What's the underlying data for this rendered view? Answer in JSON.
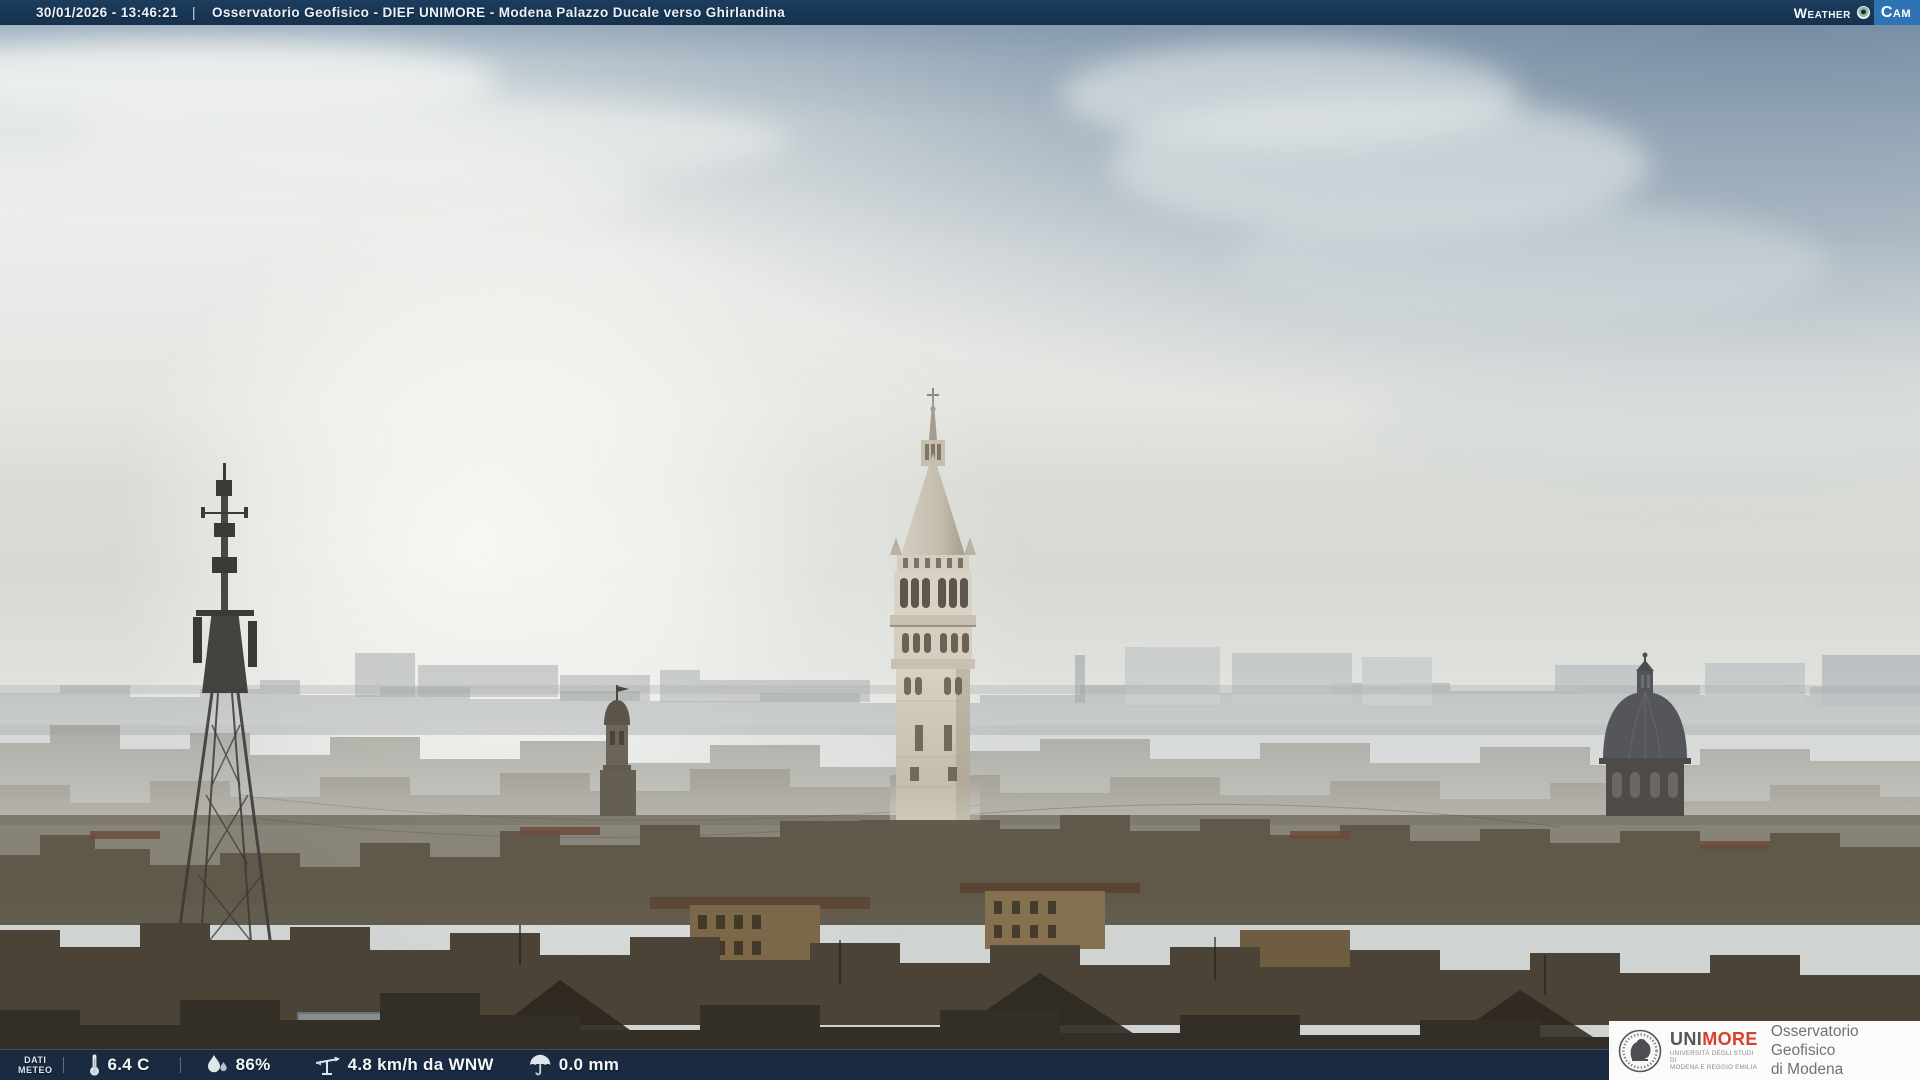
{
  "header": {
    "datetime": "30/01/2026 - 13:46:21",
    "separator": "|",
    "title": "Osservatorio Geofisico - DIEF UNIMORE - Modena Palazzo Ducale verso Ghirlandina",
    "logo": {
      "weather": "Weather",
      "cam": "Cam"
    }
  },
  "footer": {
    "label_line1": "DATI",
    "label_line2": "METEO",
    "temperature": "6.4 C",
    "humidity": "86%",
    "wind": "4.8 km/h da WNW",
    "precipitation": "0.0 mm",
    "icons": {
      "temperature": "thermometer-icon",
      "humidity": "droplets-icon",
      "wind": "wind-vane-icon",
      "precipitation": "umbrella-icon"
    }
  },
  "branding": {
    "unimore_uni": "UNI",
    "unimore_more": "MORE",
    "unimore_sub1": "UNIVERSITÀ DEGLI STUDI DI",
    "unimore_sub2": "MODENA E REGGIO EMILIA",
    "observatory_line1": "Osservatorio Geofisico",
    "observatory_line2": "di Modena"
  },
  "colors": {
    "topbar": "#16324e",
    "cam_box": "#2e74b5",
    "overlay_bar": "rgba(20,43,72,0.80)",
    "unimore_red": "#d9402f"
  }
}
